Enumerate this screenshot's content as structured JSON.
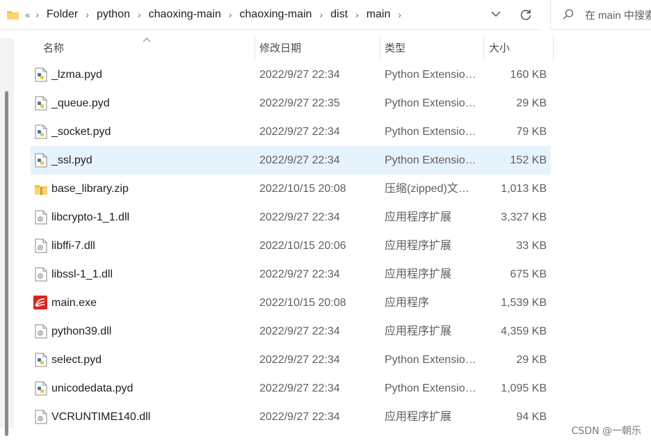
{
  "address_bar": {
    "breadcrumbs": [
      "Folder",
      "python",
      "chaoxing-main",
      "chaoxing-main",
      "dist",
      "main"
    ]
  },
  "search": {
    "placeholder": "在 main 中搜索"
  },
  "columns": {
    "name": "名称",
    "date": "修改日期",
    "type": "类型",
    "size": "大小"
  },
  "files": [
    {
      "name": "_lzma.pyd",
      "date": "2022/9/27 22:34",
      "type": "Python Extension Module",
      "size": "160 KB",
      "icon": "python-file-icon"
    },
    {
      "name": "_queue.pyd",
      "date": "2022/9/27 22:35",
      "type": "Python Extension Module",
      "size": "29 KB",
      "icon": "python-file-icon"
    },
    {
      "name": "_socket.pyd",
      "date": "2022/9/27 22:34",
      "type": "Python Extension Module",
      "size": "79 KB",
      "icon": "python-file-icon"
    },
    {
      "name": "_ssl.pyd",
      "date": "2022/9/27 22:34",
      "type": "Python Extension Module",
      "size": "152 KB",
      "icon": "python-file-icon",
      "selected": true
    },
    {
      "name": "base_library.zip",
      "date": "2022/10/15 20:08",
      "type": "压缩(zipped)文件夹",
      "size": "1,013 KB",
      "icon": "zip-folder-icon"
    },
    {
      "name": "libcrypto-1_1.dll",
      "date": "2022/9/27 22:34",
      "type": "应用程序扩展",
      "size": "3,327 KB",
      "icon": "dll-file-icon"
    },
    {
      "name": "libffi-7.dll",
      "date": "2022/10/15 20:06",
      "type": "应用程序扩展",
      "size": "33 KB",
      "icon": "dll-file-icon"
    },
    {
      "name": "libssl-1_1.dll",
      "date": "2022/9/27 22:34",
      "type": "应用程序扩展",
      "size": "675 KB",
      "icon": "dll-file-icon"
    },
    {
      "name": "main.exe",
      "date": "2022/10/15 20:08",
      "type": "应用程序",
      "size": "1,539 KB",
      "icon": "app-exe-icon"
    },
    {
      "name": "python39.dll",
      "date": "2022/9/27 22:34",
      "type": "应用程序扩展",
      "size": "4,359 KB",
      "icon": "dll-file-icon"
    },
    {
      "name": "select.pyd",
      "date": "2022/9/27 22:34",
      "type": "Python Extension Module",
      "size": "29 KB",
      "icon": "python-file-icon"
    },
    {
      "name": "unicodedata.pyd",
      "date": "2022/9/27 22:34",
      "type": "Python Extension Module",
      "size": "1,095 KB",
      "icon": "python-file-icon"
    },
    {
      "name": "VCRUNTIME140.dll",
      "date": "2022/9/27 22:34",
      "type": "应用程序扩展",
      "size": "94 KB",
      "icon": "dll-file-icon"
    }
  ],
  "watermark": "CSDN @一朝乐",
  "colors": {
    "selection": "#e5f3fd",
    "folder": "#f8c33c",
    "exe_red": "#d7261f"
  }
}
